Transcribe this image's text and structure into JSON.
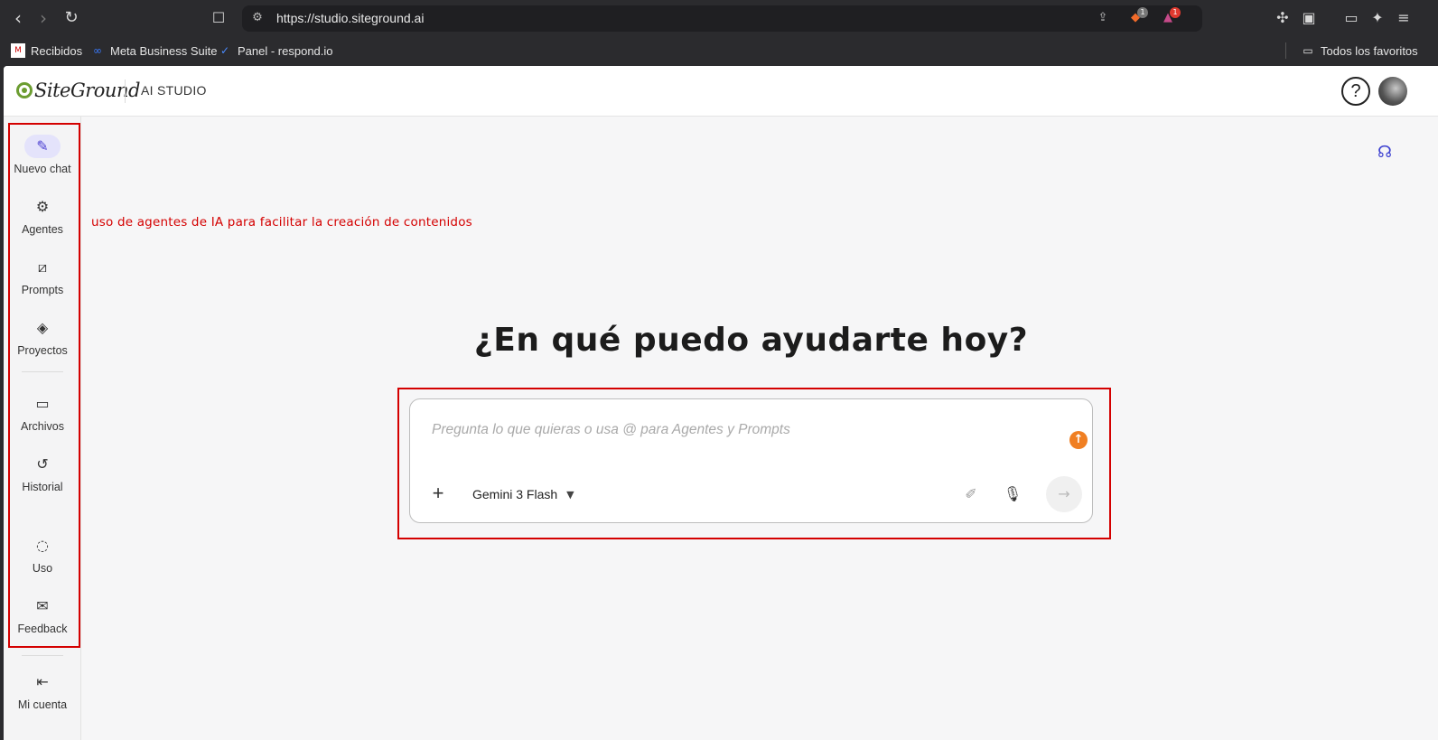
{
  "browser": {
    "url": "https://studio.siteground.ai",
    "brave_badge": "1",
    "alert_badge": "1",
    "bookmarks": [
      {
        "label": "Recibidos"
      },
      {
        "label": "Meta Business Suite"
      },
      {
        "label": "Panel - respond.io"
      }
    ],
    "all_bookmarks": "Todos los favoritos"
  },
  "header": {
    "logo_text": "SiteGround",
    "title": "AI STUDIO",
    "help_symbol": "?"
  },
  "sidebar": {
    "items": [
      {
        "label": "Nuevo chat",
        "icon": "edit-icon",
        "glyph": "✎"
      },
      {
        "label": "Agentes",
        "icon": "robot-icon",
        "glyph": "⚙"
      },
      {
        "label": "Prompts",
        "icon": "prompt-slash-icon",
        "glyph": "⧄"
      },
      {
        "label": "Proyectos",
        "icon": "layers-icon",
        "glyph": "◈"
      },
      {
        "label": "Archivos",
        "icon": "folder-icon",
        "glyph": "🗁"
      },
      {
        "label": "Historial",
        "icon": "history-icon",
        "glyph": "↺"
      },
      {
        "label": "Uso",
        "icon": "usage-ring-icon",
        "glyph": "◌"
      },
      {
        "label": "Feedback",
        "icon": "feedback-icon",
        "glyph": "✉"
      },
      {
        "label": "Mi cuenta",
        "icon": "logout-icon",
        "glyph": "⇤"
      }
    ]
  },
  "main": {
    "annotation": "uso de agentes de IA para facilitar la creación de contenidos",
    "headline": "¿En qué puedo ayudarte hoy?",
    "chat": {
      "placeholder": "Pregunta lo que quieras o usa @ para Agentes y Prompts",
      "model": "Gemini 3 Flash"
    }
  },
  "colors": {
    "accent": "#4b3fd1",
    "annotation_red": "#d40000",
    "upload_orange": "#f07f22"
  }
}
